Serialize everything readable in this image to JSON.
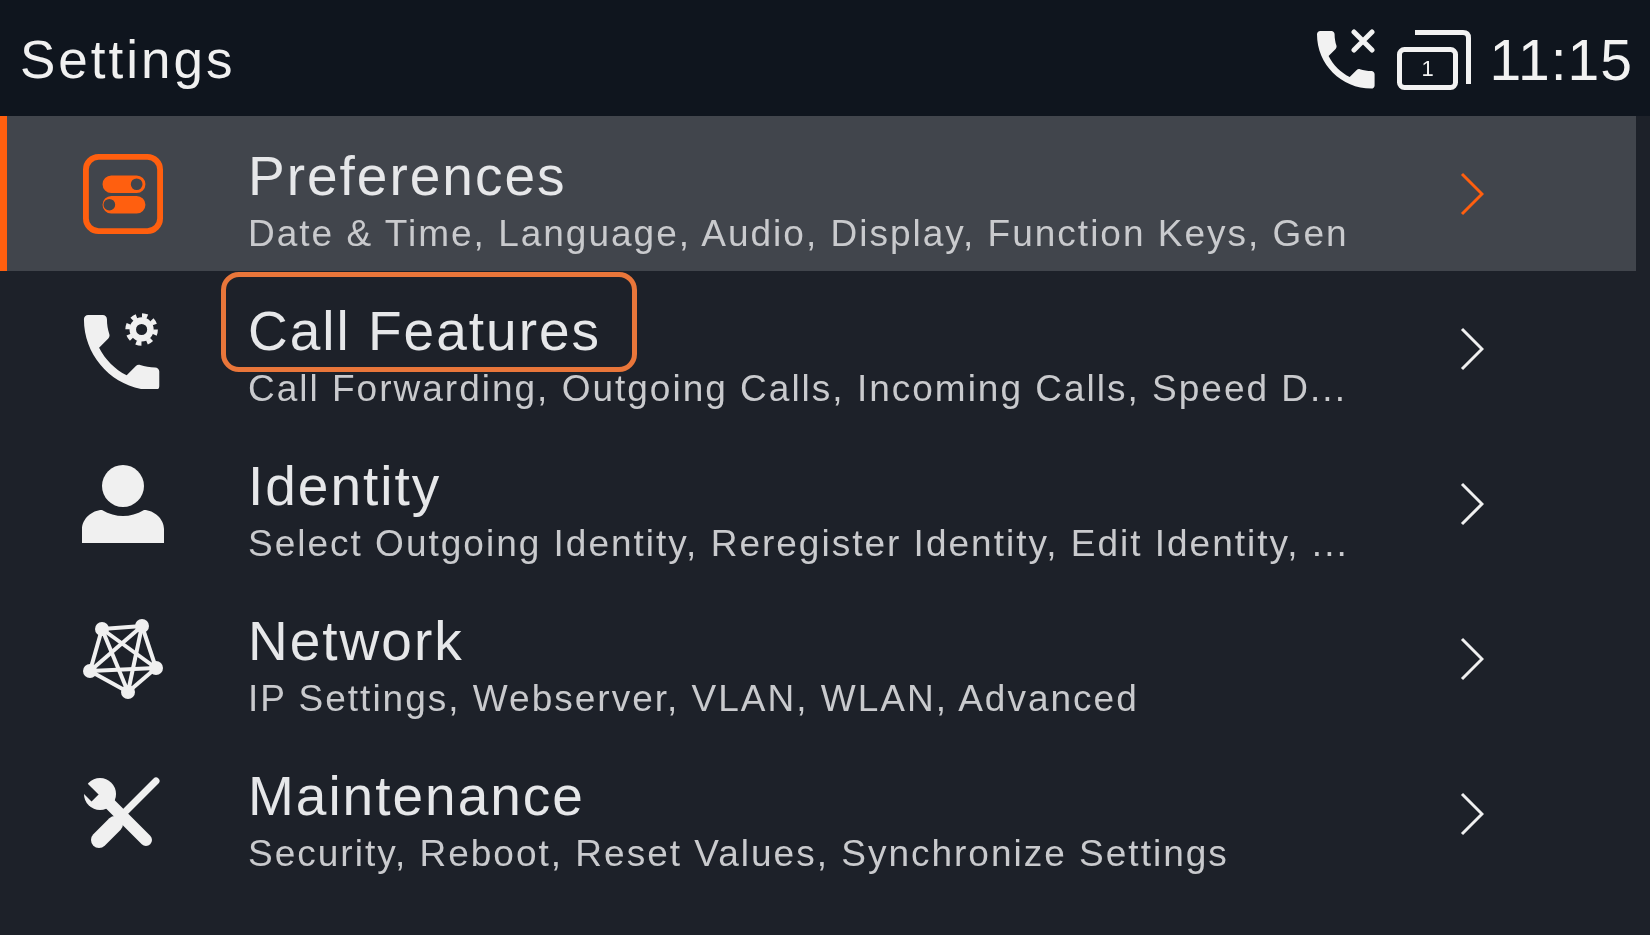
{
  "status_bar": {
    "title": "Settings",
    "window_count": "1",
    "time": "11:15"
  },
  "items": [
    {
      "title": "Preferences",
      "description": "Date & Time, Language, Audio, Display, Function Keys, Gen",
      "selected": true,
      "highlighted": false
    },
    {
      "title": "Call Features",
      "description": "Call Forwarding, Outgoing Calls, Incoming Calls, Speed D...",
      "selected": false,
      "highlighted": true
    },
    {
      "title": "Identity",
      "description": "Select Outgoing Identity, Reregister Identity, Edit Identity, ...",
      "selected": false,
      "highlighted": false
    },
    {
      "title": "Network",
      "description": "IP Settings, Webserver, VLAN, WLAN, Advanced",
      "selected": false,
      "highlighted": false
    },
    {
      "title": "Maintenance",
      "description": "Security, Reboot, Reset Values, Synchronize Settings",
      "selected": false,
      "highlighted": false
    }
  ]
}
